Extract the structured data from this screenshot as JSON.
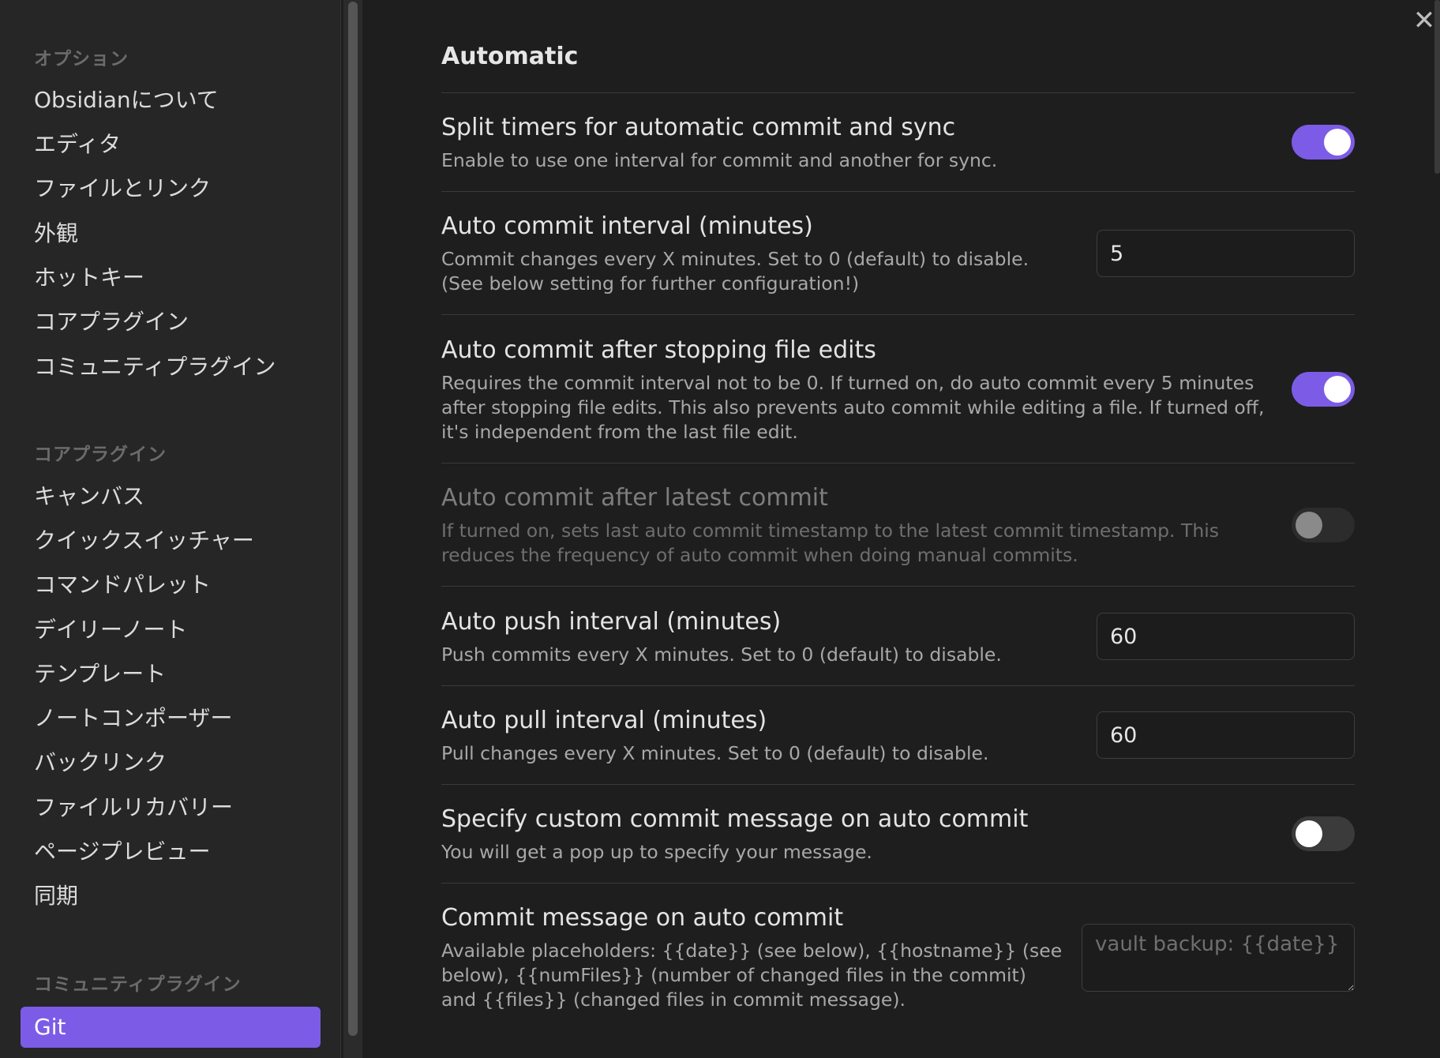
{
  "sidebar": {
    "options_heading": "オプション",
    "options_items": [
      "Obsidianについて",
      "エディタ",
      "ファイルとリンク",
      "外観",
      "ホットキー",
      "コアプラグイン",
      "コミュニティプラグイン"
    ],
    "core_heading": "コアプラグイン",
    "core_items": [
      "キャンバス",
      "クイックスイッチャー",
      "コマンドパレット",
      "デイリーノート",
      "テンプレート",
      "ノートコンポーザー",
      "バックリンク",
      "ファイルリカバリー",
      "ページプレビュー",
      "同期"
    ],
    "community_heading": "コミュニティプラグイン",
    "community_items": [
      "Git"
    ],
    "active_item": "Git"
  },
  "content": {
    "close_icon": "close-icon",
    "title": "Automatic",
    "settings": [
      {
        "name": "Split timers for automatic commit and sync",
        "desc": "Enable to use one interval for commit and another for sync.",
        "control": "toggle",
        "state": true
      },
      {
        "name": "Auto commit interval (minutes)",
        "desc": "Commit changes every X minutes. Set to 0 (default) to disable. (See below setting for further configuration!)",
        "control": "input",
        "value": "5"
      },
      {
        "name": "Auto commit after stopping file edits",
        "desc": "Requires the commit interval not to be 0. If turned on, do auto commit every 5 minutes after stopping file edits. This also prevents auto commit while editing a file. If turned off, it's independent from the last file edit.",
        "control": "toggle",
        "state": true
      },
      {
        "name": "Auto commit after latest commit",
        "desc": "If turned on, sets last auto commit timestamp to the latest commit timestamp. This reduces the frequency of auto commit when doing manual commits.",
        "control": "toggle",
        "state": false,
        "disabled": true
      },
      {
        "name": "Auto push interval (minutes)",
        "desc": "Push commits every X minutes. Set to 0 (default) to disable.",
        "control": "input",
        "value": "60"
      },
      {
        "name": "Auto pull interval (minutes)",
        "desc": "Pull changes every X minutes. Set to 0 (default) to disable.",
        "control": "input",
        "value": "60"
      },
      {
        "name": "Specify custom commit message on auto commit",
        "desc": "You will get a pop up to specify your message.",
        "control": "toggle",
        "state": false
      },
      {
        "name": "Commit message on auto commit",
        "desc": "Available placeholders: {{date}} (see below), {{hostname}} (see below), {{numFiles}} (number of changed files in the commit) and {{files}} (changed files in commit message).",
        "control": "textarea",
        "placeholder": "vault backup: {{date}}"
      }
    ]
  },
  "colors": {
    "accent": "#7c5ce6",
    "background": "#1e1e1e",
    "sidebar": "#262626"
  }
}
